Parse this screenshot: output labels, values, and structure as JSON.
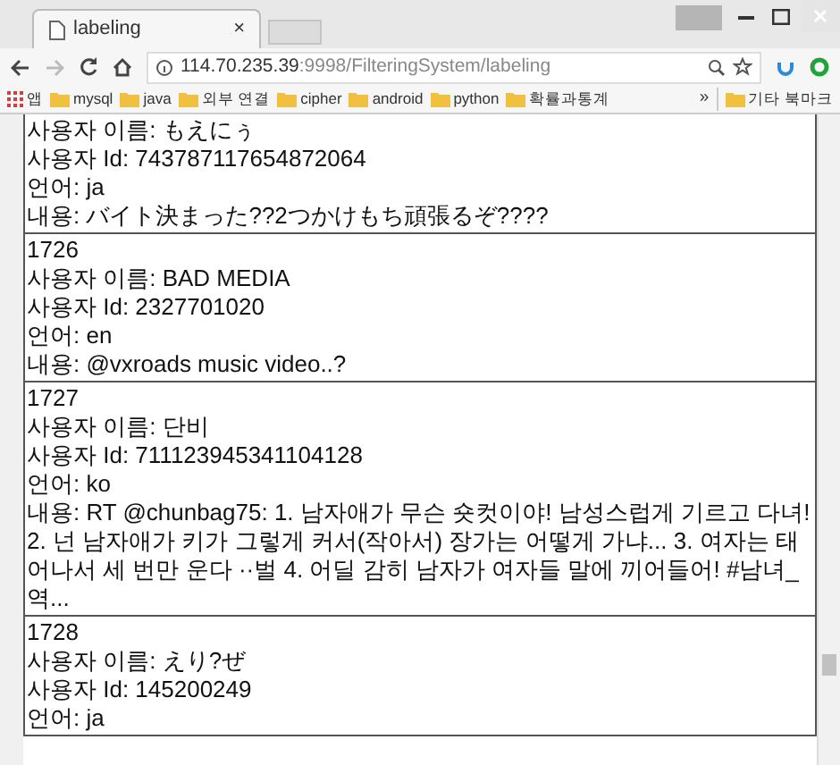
{
  "browser": {
    "tab": {
      "title": "labeling",
      "close": "×"
    },
    "address": {
      "host": "114.70.235.39",
      "path": ":9998/FilteringSystem/labeling"
    },
    "bookmarks": [
      {
        "label": "앱",
        "kind": "apps"
      },
      {
        "label": "mysql",
        "kind": "folder"
      },
      {
        "label": "java",
        "kind": "folder"
      },
      {
        "label": "외부 연결",
        "kind": "folder"
      },
      {
        "label": "cipher",
        "kind": "folder"
      },
      {
        "label": "android",
        "kind": "folder"
      },
      {
        "label": "python",
        "kind": "folder"
      },
      {
        "label": "확률과통계",
        "kind": "folder"
      }
    ],
    "overflow": "»",
    "other_bookmarks": "기타 북마크"
  },
  "records": [
    {
      "lines": [
        "사용자 이름: もえにぅ",
        "사용자 Id: 743787117654872064",
        "언어: ja",
        "내용: バイト決まった??2つかけもち頑張るぞ????"
      ]
    },
    {
      "lines": [
        "1726",
        "사용자 이름: BAD MEDIA",
        "사용자 Id: 2327701020",
        "언어: en",
        "내용: @vxroads music video..?"
      ]
    },
    {
      "lines": [
        "1727",
        "사용자 이름: 단비",
        "사용자 Id: 711123945341104128",
        "언어: ko",
        "내용: RT @chunbag75: 1. 남자애가 무슨 숏컷이야! 남성스럽게 기르고 다녀! 2. 넌 남자애가 키가 그렇게 커서(작아서) 장가는 어떻게 가냐... 3. 여자는 태어나서 세 번만 운다 ··벌 4. 어딜 감히 남자가 여자들 말에 끼어들어! #남녀_역..."
      ]
    },
    {
      "lines": [
        "1728",
        "사용자 이름: えり?ぜ",
        "사용자 Id: 145200249",
        "언어: ja"
      ]
    }
  ]
}
